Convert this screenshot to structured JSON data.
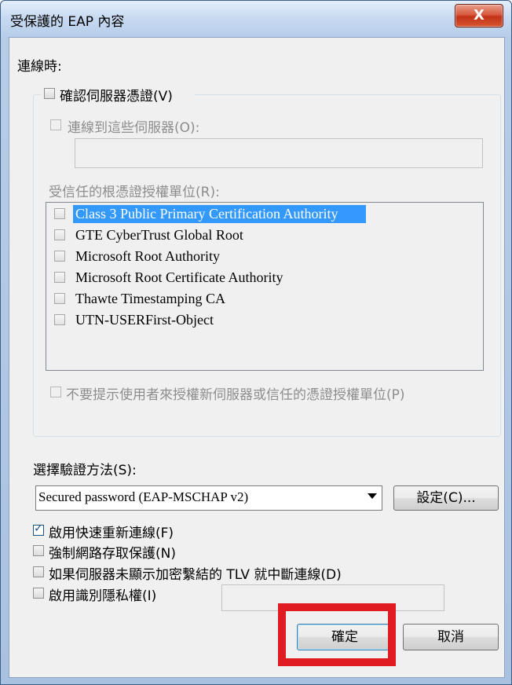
{
  "window": {
    "title": "受保護的 EAP 內容",
    "close_label": "X"
  },
  "connect_label": "連線時:",
  "verify_cert": {
    "label": "確認伺服器憑證(V)",
    "checked": false
  },
  "connect_servers": {
    "label": "連線到這些伺服器(O):",
    "checked": false,
    "value": ""
  },
  "trusted_ca_label": "受信任的根憑證授權單位(R):",
  "ca_list": [
    {
      "label": "Class 3 Public Primary Certification Authority",
      "checked": false,
      "selected": true
    },
    {
      "label": "GTE CyberTrust Global Root",
      "checked": false,
      "selected": false
    },
    {
      "label": "Microsoft Root Authority",
      "checked": false,
      "selected": false
    },
    {
      "label": "Microsoft Root Certificate Authority",
      "checked": false,
      "selected": false
    },
    {
      "label": "Thawte Timestamping CA",
      "checked": false,
      "selected": false
    },
    {
      "label": "UTN-USERFirst-Object",
      "checked": false,
      "selected": false
    }
  ],
  "no_prompt": {
    "label": "不要提示使用者來授權新伺服器或信任的憑證授權單位(P)",
    "checked": false
  },
  "auth_method": {
    "label": "選擇驗證方法(S):",
    "selected": "Secured password (EAP-MSCHAP v2)",
    "configure_label": "設定(C)..."
  },
  "options": [
    {
      "label": "啟用快速重新連線(F)",
      "checked": true
    },
    {
      "label": "強制網路存取保護(N)",
      "checked": false
    },
    {
      "label": "如果伺服器未顯示加密繫結的 TLV 就中斷連線(D)",
      "checked": false
    },
    {
      "label": "啟用識別隱私權(I)",
      "checked": false,
      "value": ""
    }
  ],
  "buttons": {
    "ok": "確定",
    "cancel": "取消"
  },
  "colors": {
    "highlight": "#e11b22",
    "selection": "#3399ff"
  }
}
